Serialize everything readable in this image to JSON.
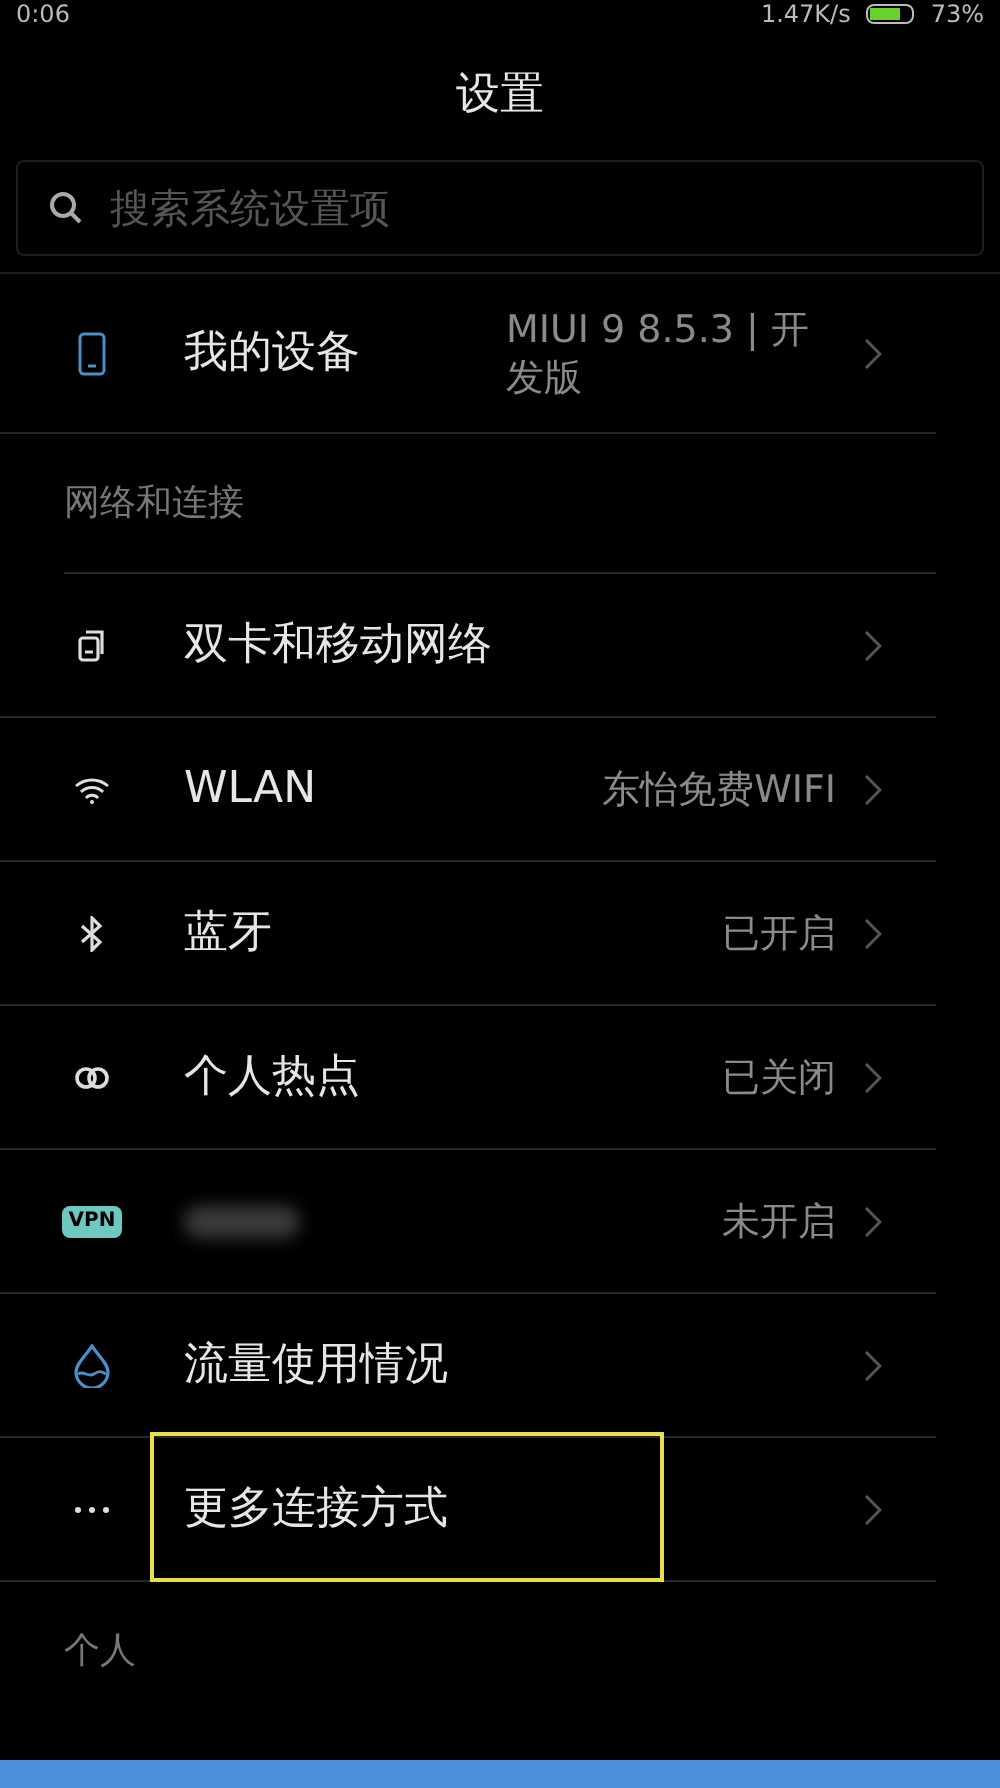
{
  "status_bar": {
    "time": "0:06",
    "speed": "1.47K/s",
    "battery": "73%"
  },
  "title": "设置",
  "search": {
    "placeholder": "搜索系统设置项"
  },
  "sections": [
    {
      "items": [
        {
          "kind": "device",
          "label": "我的设备",
          "value": "MIUI 9 8.5.3 | 开发版"
        }
      ]
    },
    {
      "header": "网络和连接",
      "items": [
        {
          "kind": "sim",
          "label": "双卡和移动网络"
        },
        {
          "kind": "wifi",
          "label": "WLAN",
          "value": "东怡免费WIFI"
        },
        {
          "kind": "bluetooth",
          "label": "蓝牙",
          "value": "已开启"
        },
        {
          "kind": "hotspot",
          "label": "个人热点",
          "value": "已关闭"
        },
        {
          "kind": "vpn",
          "icon_text": "VPN",
          "blurred": true,
          "value": "未开启"
        },
        {
          "kind": "data",
          "label": "流量使用情况"
        },
        {
          "kind": "more",
          "label": "更多连接方式",
          "highlighted": true
        }
      ]
    },
    {
      "header": "个人"
    }
  ]
}
